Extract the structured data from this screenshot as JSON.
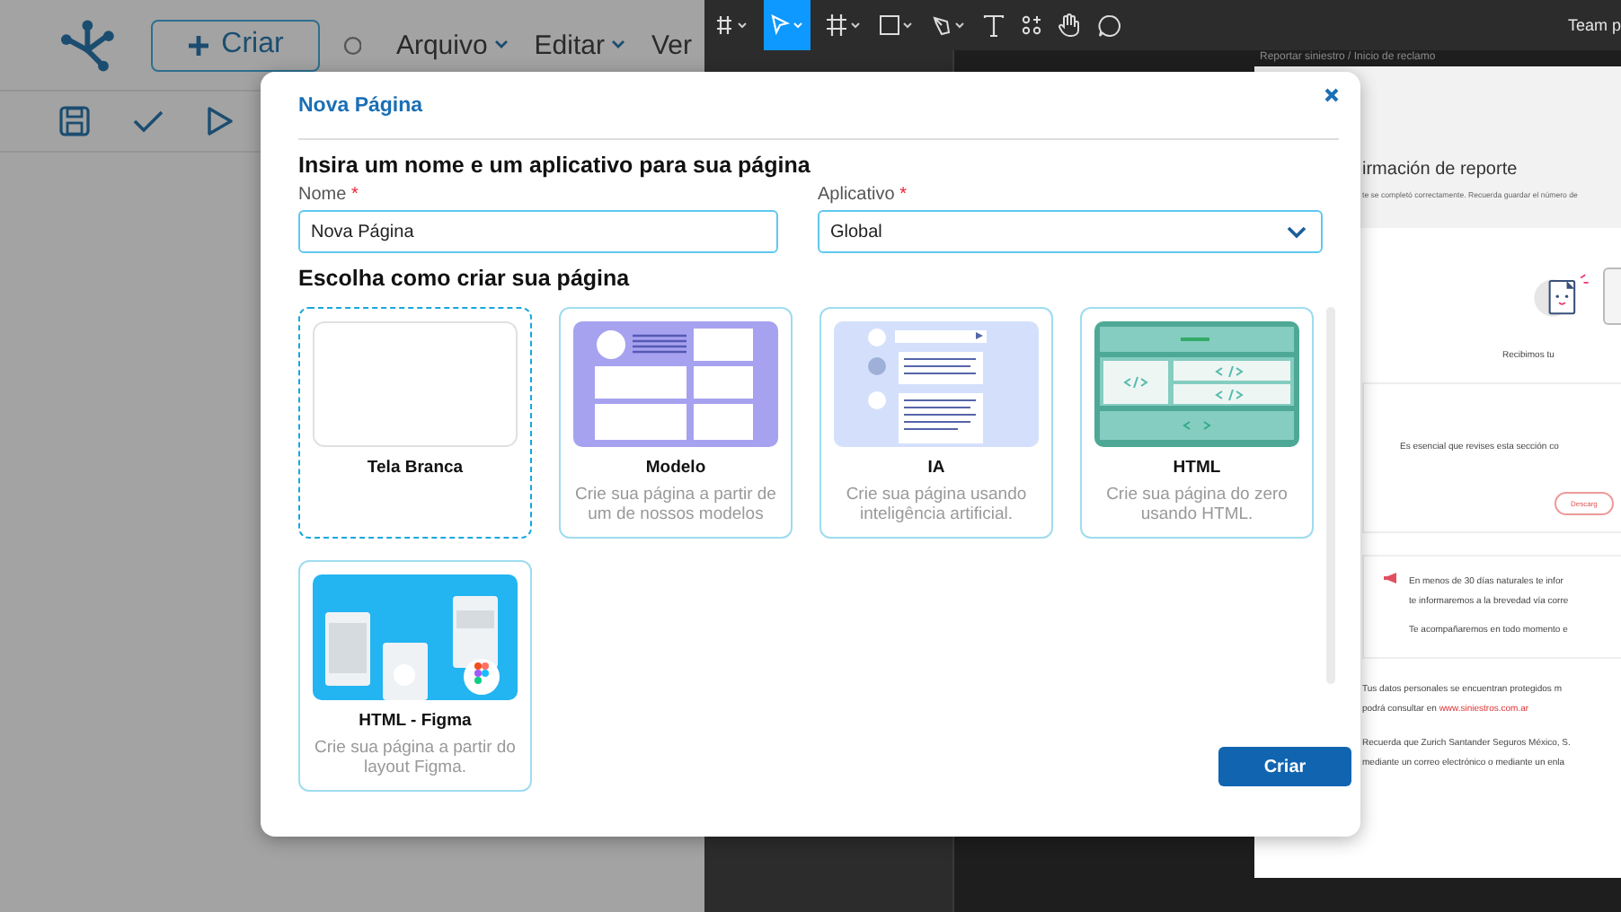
{
  "app_bar": {
    "create_button": "Criar",
    "menus": [
      {
        "label": "Arquivo",
        "has_menu": true
      },
      {
        "label": "Editar",
        "has_menu": true
      },
      {
        "label": "Ver",
        "has_menu": false
      }
    ]
  },
  "figma": {
    "team": "Team p",
    "breadcrumb": "Reportar siniestro / Inicio de reclamo",
    "document": {
      "heading": "irmación de reporte",
      "subheading": "te se completó correctamente. Recuerda guardar el número de",
      "received": "Recibimos tu",
      "notice": "Es esencial que revises esta sección co",
      "download_button": "Descarg",
      "info_lines": [
        "En menos de 30 días naturales te infor",
        "te informaremos a la brevedad vía corre",
        "Te acompañaremos en todo momento e"
      ],
      "privacy": "Tus datos personales se encuentran protegidos m",
      "consult": "podrá consultar en ",
      "link": "www.siniestros.com.ar",
      "reminder_lines": [
        "Recuerda que Zurich Santander Seguros México, S.",
        "mediante un correo electrónico o mediante un enla"
      ]
    }
  },
  "dialog": {
    "title": "Nova Página",
    "section_1": "Insira um nome e um aplicativo para sua página",
    "fields": [
      {
        "kind": "text",
        "label": "Nome",
        "required_mark": "*",
        "value": "Nova Página"
      },
      {
        "kind": "select",
        "label": "Aplicativo",
        "required_mark": "*",
        "value": "Global"
      }
    ],
    "section_2": "Escolha como criar sua página",
    "options": [
      {
        "kind": "blank",
        "title": "Tela Branca",
        "selected": true
      },
      {
        "kind": "template",
        "title": "Modelo",
        "description": "Crie sua página a partir de um de nossos modelos",
        "selected": false
      },
      {
        "kind": "ai",
        "title": "IA",
        "description": "Crie sua página usando inteligência artificial.",
        "selected": false
      },
      {
        "kind": "html",
        "title": "HTML",
        "description": "Crie sua página do zero usando HTML.",
        "selected": false
      },
      {
        "kind": "figma",
        "title": "HTML - Figma",
        "description": "Crie sua página a partir do layout Figma.",
        "selected": false
      }
    ],
    "submit": "Criar"
  }
}
